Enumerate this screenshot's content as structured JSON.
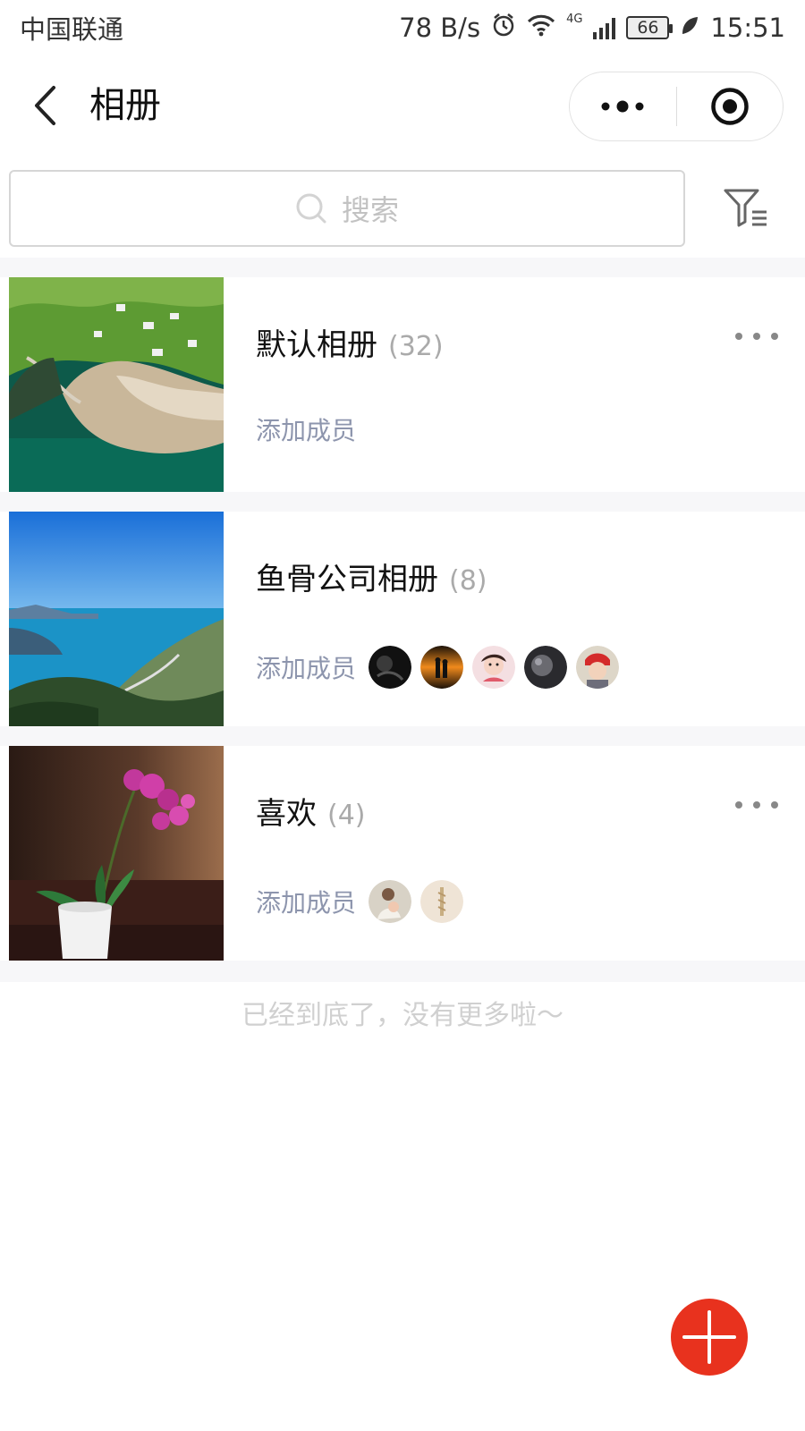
{
  "status_bar": {
    "carrier": "中国联通",
    "net_speed": "78 B/s",
    "network_type": "4G",
    "battery": "66",
    "time": "15:51"
  },
  "nav": {
    "title": "相册",
    "back_icon": "back-chevron-icon",
    "menu_icon": "more-dots-icon",
    "close_icon": "target-circle-icon"
  },
  "search": {
    "placeholder": "搜索",
    "filter_icon": "filter-list-icon"
  },
  "albums": [
    {
      "name": "默认相册",
      "count": "(32)",
      "add_member": "添加成员",
      "cover": "coastal-cliff-village-photo",
      "members": [],
      "show_more": true
    },
    {
      "name": "鱼骨公司相册",
      "count": "(8)",
      "add_member": "添加成员",
      "cover": "lake-mountain-view-photo",
      "members": [
        "member-avatar-1",
        "member-avatar-2",
        "member-avatar-3",
        "member-avatar-4",
        "member-avatar-5"
      ],
      "show_more": false
    },
    {
      "name": "喜欢",
      "count": "(4)",
      "add_member": "添加成员",
      "cover": "pink-orchid-pot-photo",
      "members": [
        "member-avatar-1",
        "member-avatar-2"
      ],
      "show_more": true
    }
  ],
  "footer": {
    "end_text": "已经到底了，没有更多啦～"
  },
  "fab": {
    "icon": "plus-icon"
  },
  "colors": {
    "accent": "#e8321e",
    "secondary_text": "#8d95ad",
    "background": "#f7f7f9"
  }
}
